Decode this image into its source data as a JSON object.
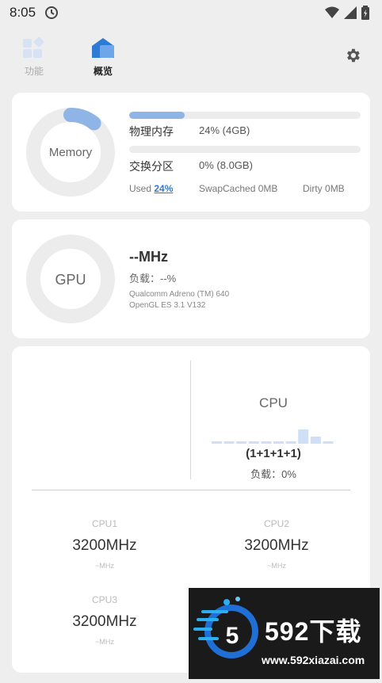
{
  "status_bar": {
    "time": "8:05"
  },
  "tabs": [
    {
      "label": "功能",
      "active": false
    },
    {
      "label": "概览",
      "active": true
    }
  ],
  "memory": {
    "ring_label": "Memory",
    "physical_label": "物理内存",
    "physical_value": "24% (4GB)",
    "physical_percent": 24,
    "swap_label": "交换分区",
    "swap_value": "0% (8.0GB)",
    "swap_percent": 0,
    "used_label": "Used",
    "used_value": "24%",
    "swapcached_label": "SwapCached",
    "swapcached_value": "0MB",
    "dirty_label": "Dirty",
    "dirty_value": "0MB"
  },
  "gpu": {
    "ring_label": "GPU",
    "freq": "--MHz",
    "load": "负载：--%",
    "model": "Qualcomm Adreno (TM) 640",
    "api": "OpenGL ES 3.1 V132"
  },
  "cpu": {
    "title": "CPU",
    "cores_summary": "(1+1+1+1)",
    "load": "负载：0%",
    "core_levels": [
      0.0,
      0.0,
      0.0,
      0.0,
      0.0,
      0.0,
      0.0,
      1.0,
      0.5,
      0.0
    ],
    "cores": [
      {
        "name": "CPU1",
        "freq": "3200MHz",
        "unit": "~MHz"
      },
      {
        "name": "CPU2",
        "freq": "3200MHz",
        "unit": "~MHz"
      },
      {
        "name": "CPU3",
        "freq": "3200MHz",
        "unit": "~MHz"
      }
    ]
  },
  "watermark": {
    "brand": "592下载",
    "url": "www.592xiazai.com",
    "logo_digit": "5"
  },
  "colors": {
    "accent": "#2e7bd6",
    "ring_bg": "#ececec",
    "ring_fill": "#8fb4e6",
    "cpu_bar": "#cfe0f6",
    "watermark_bg": "#1a1a1a"
  }
}
